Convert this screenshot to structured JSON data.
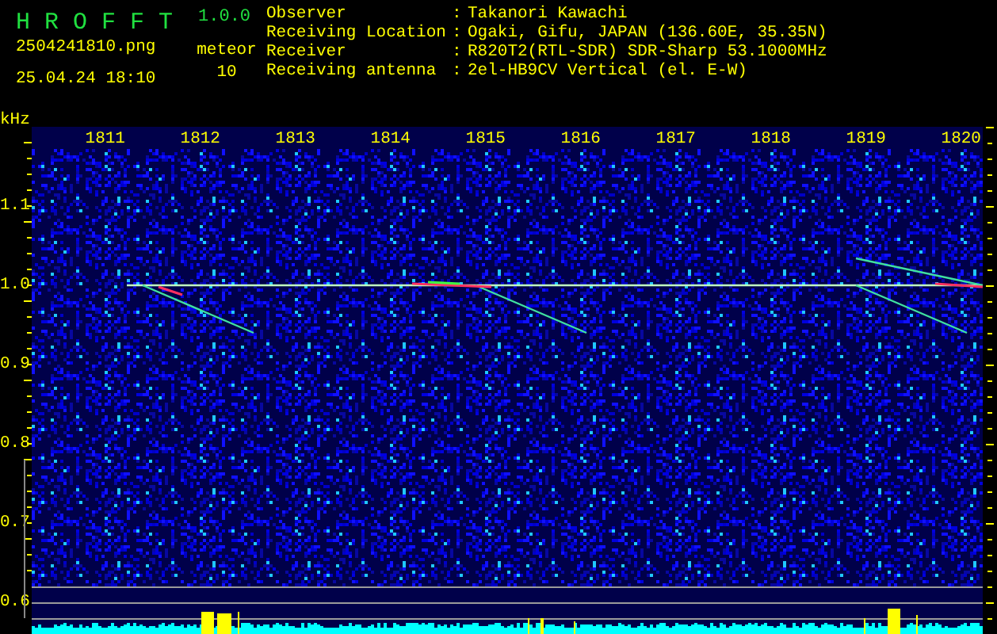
{
  "header": {
    "app_name": "H R O F F T",
    "version": "1.0.0",
    "file_name": "2504241810.png",
    "timestamp": "25.04.24 18:10",
    "count_label": "meteor",
    "count": "10"
  },
  "station_info": [
    {
      "label": "Observer",
      "separator": ":",
      "value": "Takanori Kawachi"
    },
    {
      "label": "Receiving Location",
      "separator": ":",
      "value": "Ogaki, Gifu, JAPAN (136.60E, 35.35N)"
    },
    {
      "label": "Receiver",
      "separator": ":",
      "value": "R820T2(RTL-SDR) SDR-Sharp 53.1000MHz"
    },
    {
      "label": "Receiving antenna",
      "separator": ":",
      "value": "2el-HB9CV Vertical (el. E-W)"
    }
  ],
  "spectrogram": {
    "y_unit": "kHz",
    "x_labels": [
      "1811",
      "1812",
      "1813",
      "1814",
      "1815",
      "1816",
      "1817",
      "1818",
      "1819",
      "1820"
    ],
    "y_labels": [
      "1.1",
      "1.0",
      "0.9",
      "0.8",
      "0.7",
      "0.6"
    ]
  }
}
